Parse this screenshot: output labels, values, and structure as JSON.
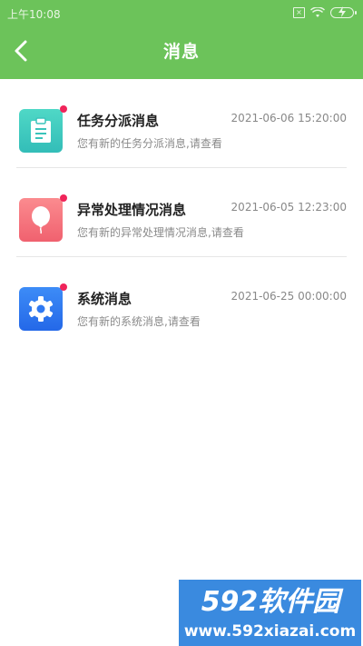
{
  "status_bar": {
    "time": "上午10:08"
  },
  "nav": {
    "title": "消息"
  },
  "messages": [
    {
      "title": "任务分派消息",
      "time": "2021-06-06 15:20:00",
      "desc": "您有新的任务分派消息,请查看",
      "icon": "clipboard-icon",
      "color": "#43cfc0"
    },
    {
      "title": "异常处理情况消息",
      "time": "2021-06-05 12:23:00",
      "desc": "您有新的异常处理情况消息,请查看",
      "icon": "balloon-icon",
      "color": "#f46c7a"
    },
    {
      "title": "系统消息",
      "time": "2021-06-25 00:00:00",
      "desc": "您有新的系统消息,请查看",
      "icon": "gear-icon",
      "color": "#2f79f2"
    }
  ],
  "watermark": {
    "logo": "592软件园",
    "url": "www.592xiazai.com"
  },
  "colors": {
    "header": "#6cc35a",
    "unread_dot": "#f0245a",
    "watermark_bg": "#3a8adf"
  }
}
